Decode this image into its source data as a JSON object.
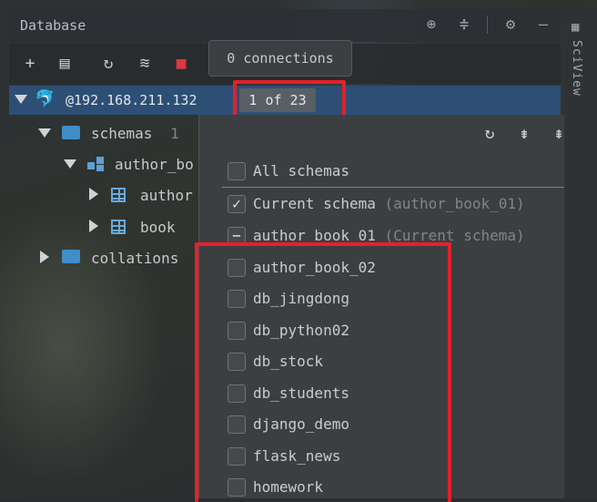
{
  "panel": {
    "title": "Database",
    "header_icons": [
      "crosshair-icon",
      "collapse-icon",
      "gear-icon",
      "minimize-icon"
    ]
  },
  "toolbar": {
    "buttons": [
      "add-icon",
      "copy-icon",
      "refresh-icon",
      "schema-edit-icon",
      "stop-icon"
    ]
  },
  "tooltip": {
    "text": "0 connections"
  },
  "connection": {
    "label": "@192.168.211.132",
    "count_badge": "1 of 23"
  },
  "tree": {
    "schemas": {
      "label": "schemas",
      "count": "1"
    },
    "schema_node": "author_bo",
    "tables": [
      "author",
      "book"
    ],
    "collations": "collations"
  },
  "popup": {
    "tools": [
      "refresh-icon",
      "expand-all-icon",
      "collapse-all-icon"
    ],
    "options": [
      {
        "label": "All schemas",
        "sub": "",
        "state": "unchecked"
      },
      {
        "label": "Current schema",
        "sub": "(author_book_01)",
        "state": "checked"
      },
      {
        "label": "author_book_01",
        "sub": "(Current schema)",
        "state": "partial"
      },
      {
        "label": "author_book_02",
        "sub": "",
        "state": "unchecked"
      },
      {
        "label": "db_jingdong",
        "sub": "",
        "state": "unchecked"
      },
      {
        "label": "db_python02",
        "sub": "",
        "state": "unchecked"
      },
      {
        "label": "db_stock",
        "sub": "",
        "state": "unchecked"
      },
      {
        "label": "db_students",
        "sub": "",
        "state": "unchecked"
      },
      {
        "label": "django_demo",
        "sub": "",
        "state": "unchecked"
      },
      {
        "label": "flask_news",
        "sub": "",
        "state": "unchecked"
      },
      {
        "label": "homework",
        "sub": "",
        "state": "unchecked"
      }
    ]
  },
  "sidebar": {
    "label": "SciView"
  },
  "colors": {
    "highlight": "#e5202a",
    "selection": "#2d4f75",
    "folder": "#3f8ec9"
  }
}
